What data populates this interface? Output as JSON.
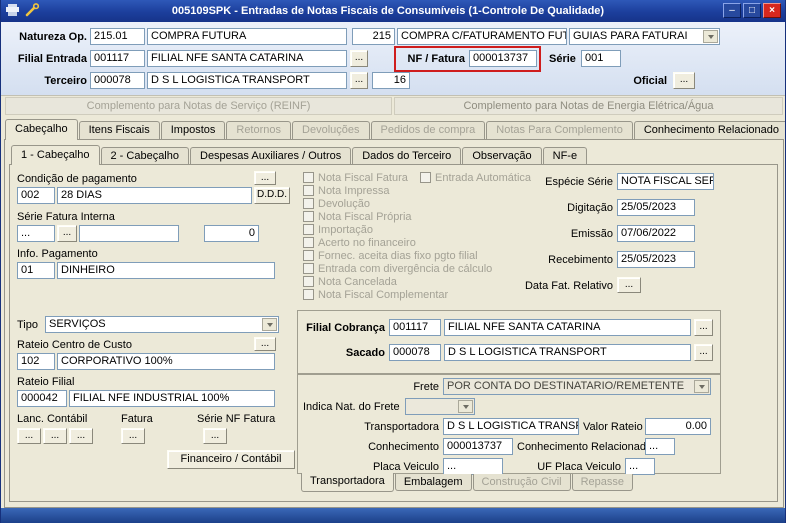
{
  "ui": {
    "dots": "...",
    "minimize_glyph": "–",
    "maximize_glyph": "□",
    "close_glyph": "×"
  },
  "window": {
    "title": "005109SPK - Entradas de Notas Fiscais de Consumíveis (1-Controle De Qualidade)"
  },
  "colors": {
    "titlebar": "#1c3f9c",
    "highlight": "#cf1d1d",
    "field_border": "#7f9db9",
    "form_bg": "#ece9d8"
  },
  "header": {
    "natureza_label": "Natureza Op.",
    "natureza_code": "215.01",
    "natureza_name": "COMPRA FUTURA",
    "natureza_code2": "215",
    "natureza_name2": "COMPRA C/FATURAMENTO FUTURO",
    "natureza_tipo": "GUIAS PARA FATURAI",
    "filial_label": "Filial Entrada",
    "filial_code": "001117",
    "filial_name": "FILIAL NFE SANTA CATARINA",
    "nf_label": "NF / Fatura",
    "nf_value": "000013737",
    "serie_label": "Série",
    "serie_value": "001",
    "terceiro_label": "Terceiro",
    "terceiro_code": "000078",
    "terceiro_name": "D S L LOGISTICA TRANSPORT",
    "terceiro_loja": "16",
    "oficial_label": "Oficial"
  },
  "complements": {
    "servico": "Complemento para Notas de Serviço (REINF)",
    "energia": "Complemento para Notas de Energia Elétrica/Água"
  },
  "tabs_main": [
    {
      "label": "Cabeçalho",
      "state": "active"
    },
    {
      "label": "Itens Fiscais",
      "state": "normal"
    },
    {
      "label": "Impostos",
      "state": "normal"
    },
    {
      "label": "Retornos",
      "state": "disabled"
    },
    {
      "label": "Devoluções",
      "state": "disabled"
    },
    {
      "label": "Pedidos de compra",
      "state": "disabled"
    },
    {
      "label": "Notas Para Complemento",
      "state": "disabled"
    },
    {
      "label": "Conhecimento Relacionado",
      "state": "normal"
    }
  ],
  "tabs_sub": [
    {
      "label": "1 - Cabeçalho",
      "state": "active"
    },
    {
      "label": "2 - Cabeçalho",
      "state": "normal"
    },
    {
      "label": "Despesas Auxiliares / Outros",
      "state": "normal"
    },
    {
      "label": "Dados do Terceiro",
      "state": "normal"
    },
    {
      "label": "Observação",
      "state": "normal"
    },
    {
      "label": "NF-e",
      "state": "normal"
    }
  ],
  "left": {
    "cond_label": "Condição de pagamento",
    "cond_code": "002",
    "cond_name": "28 DIAS",
    "cond_btn": "D.D.D.",
    "serie_fatura_label": "Série Fatura Interna",
    "serie_fatura_v1": "...",
    "serie_fatura_v2": "",
    "serie_fatura_v3": "0",
    "info_label": "Info. Pagamento",
    "info_code": "01",
    "info_name": "DINHEIRO",
    "tipo_label": "Tipo",
    "tipo_value": "SERVIÇOS",
    "rateio_cc_label": "Rateio Centro de Custo",
    "rateio_cc_code": "102",
    "rateio_cc_name": "CORPORATIVO 100%",
    "rateio_filial_label": "Rateio Filial",
    "rateio_filial_code": "000042",
    "rateio_filial_name": "FILIAL NFE INDUSTRIAL 100%",
    "lanc_label": "Lanc. Contábil",
    "fatura_label": "Fatura",
    "serie_nf_label": "Série NF Fatura",
    "financeiro_btn": "Financeiro / Contábil"
  },
  "checkboxes": [
    {
      "label": "Nota Fiscal Fatura",
      "checked": false
    },
    {
      "label": "Entrada Automática",
      "checked": false
    },
    {
      "label": "Nota Impressa",
      "checked": false
    },
    {
      "label": "Devolução",
      "checked": false
    },
    {
      "label": "Nota Fiscal Própria",
      "checked": false
    },
    {
      "label": "Importação",
      "checked": false
    },
    {
      "label": "Acerto no financeiro",
      "checked": false
    },
    {
      "label": "Fornec. aceita dias fixo pgto filial",
      "checked": false
    },
    {
      "label": "Entrada com divergência de cálculo",
      "checked": false
    },
    {
      "label": "Nota Cancelada",
      "checked": false
    },
    {
      "label": "Nota Fiscal Complementar",
      "checked": false
    }
  ],
  "right": {
    "especie_label": "Espécie Série",
    "especie_value": "NOTA FISCAL SER",
    "digitacao_label": "Digitação",
    "digitacao_value": "25/05/2023",
    "emissao_label": "Emissão",
    "emissao_value": "07/06/2022",
    "recebimento_label": "Recebimento",
    "recebimento_value": "25/05/2023",
    "data_fat_label": "Data Fat. Relativo"
  },
  "cobranca": {
    "filial_label": "Filial Cobrança",
    "filial_code": "001117",
    "filial_name": "FILIAL NFE SANTA CATARINA",
    "sacado_label": "Sacado",
    "sacado_code": "000078",
    "sacado_name": "D S L LOGISTICA TRANSPORT",
    "frete_label": "Frete",
    "frete_value": "POR CONTA DO DESTINATARIO/REMETENTE",
    "indica_label": "Indica Nat. do Frete",
    "indica_value": "",
    "transp_label": "Transportadora",
    "transp_value": "D S L LOGISTICA TRANSPOI",
    "valor_rateio_label": "Valor Rateio",
    "valor_rateio_value": "0.00",
    "conhecimento_label": "Conhecimento",
    "conhecimento_value": "000013737",
    "conhecimento_rel_label": "Conhecimento Relacionado",
    "conhecimento_rel_value": "...",
    "placa_label": "Placa Veiculo",
    "placa_value": "...",
    "uf_label": "UF Placa Veiculo",
    "uf_value": "...",
    "tabs": [
      {
        "label": "Transportadora",
        "state": "active"
      },
      {
        "label": "Embalagem",
        "state": "normal"
      },
      {
        "label": "Construção Civil",
        "state": "disabled"
      },
      {
        "label": "Repasse",
        "state": "disabled"
      }
    ]
  }
}
